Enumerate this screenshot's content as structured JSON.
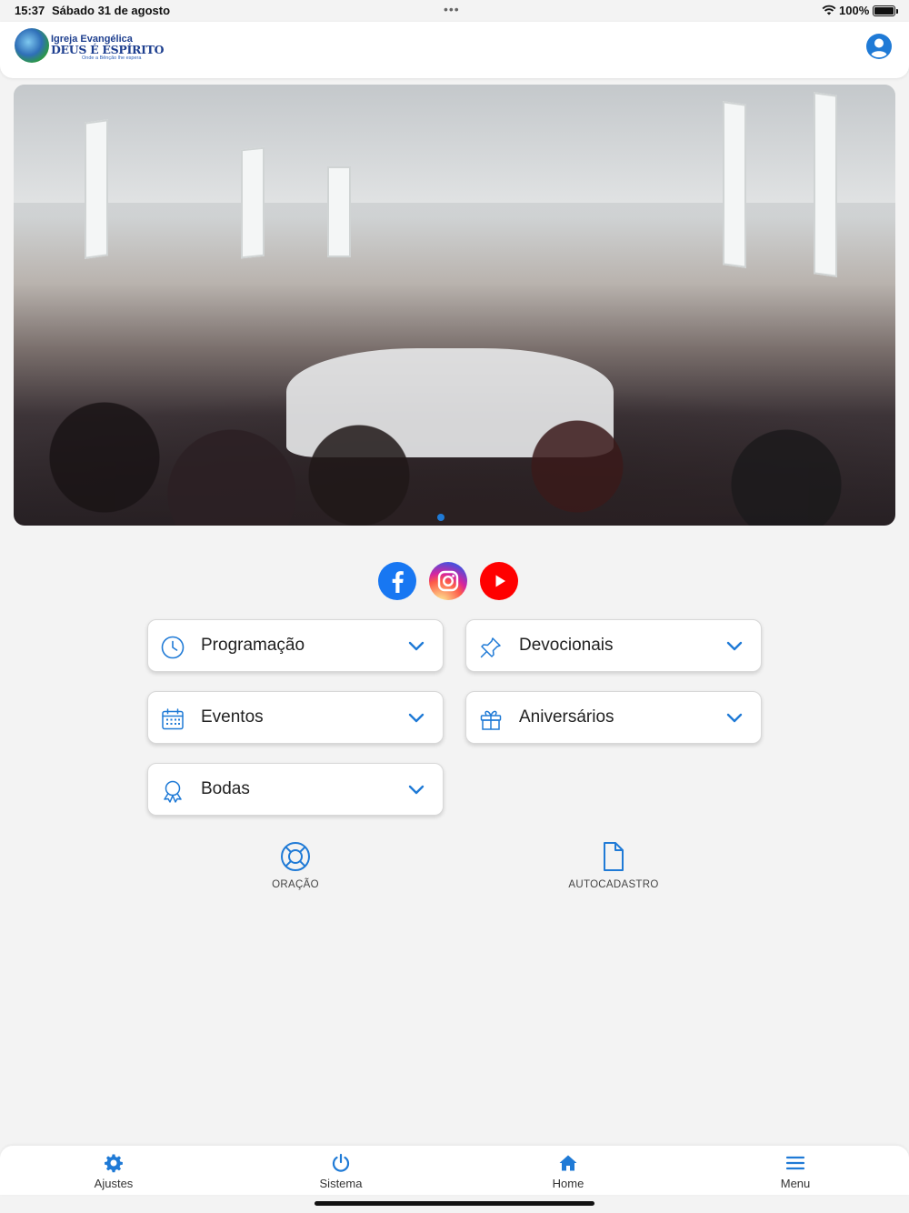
{
  "status_bar": {
    "time": "15:37",
    "date": "Sábado 31 de agosto",
    "battery": "100%"
  },
  "header": {
    "logo": {
      "line1": "Igreja Evangélica",
      "line2": "DEUS É ESPÍRITO",
      "line3": "Onde a Bênção lhe espera"
    },
    "profile_icon": "user-circle-icon"
  },
  "carousel": {
    "active_index": 0,
    "slide_count": 1
  },
  "social": [
    "facebook",
    "instagram",
    "youtube"
  ],
  "cards": [
    {
      "label": "Programação",
      "icon": "clock-icon"
    },
    {
      "label": "Devocionais",
      "icon": "pin-icon"
    },
    {
      "label": "Eventos",
      "icon": "calendar-icon"
    },
    {
      "label": "Aniversários",
      "icon": "gift-icon"
    },
    {
      "label": "Bodas",
      "icon": "award-icon"
    }
  ],
  "shortcuts": [
    {
      "label": "ORAÇÃO",
      "icon": "lifebuoy-icon"
    },
    {
      "label": "AUTOCADASTRO",
      "icon": "document-icon"
    }
  ],
  "tabbar": [
    {
      "label": "Ajustes",
      "icon": "gear-icon"
    },
    {
      "label": "Sistema",
      "icon": "power-icon"
    },
    {
      "label": "Home",
      "icon": "home-icon"
    },
    {
      "label": "Menu",
      "icon": "menu-icon"
    }
  ],
  "colors": {
    "accent": "#1f7ad6",
    "background": "#f3f3f3",
    "card_border": "#d8d8d8"
  }
}
